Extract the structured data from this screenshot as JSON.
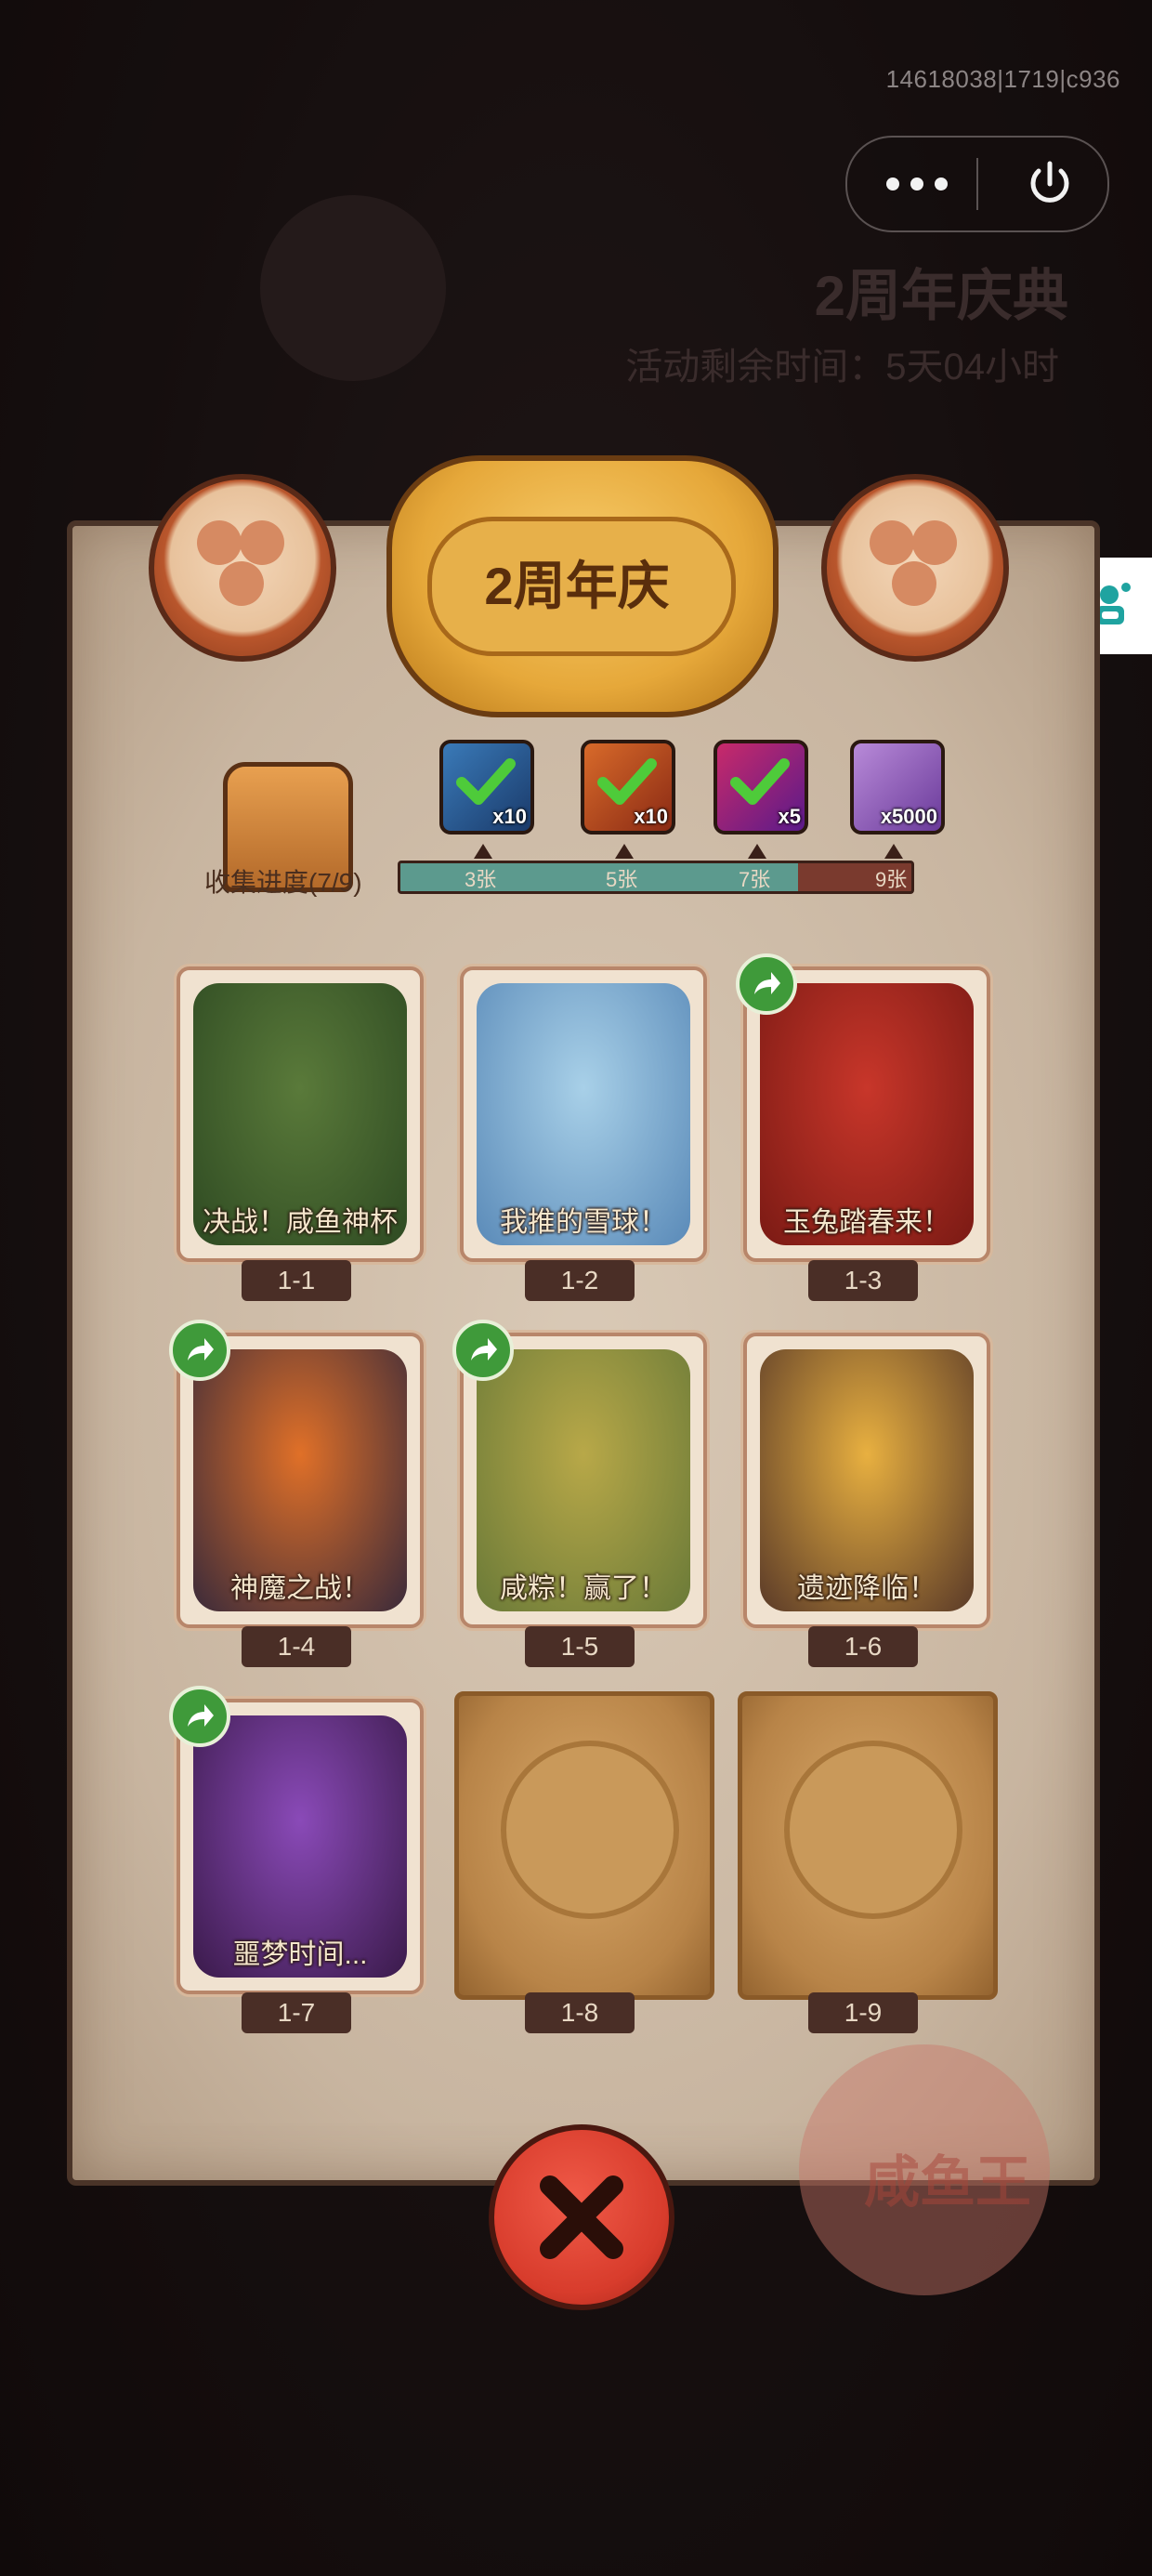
{
  "system": {
    "version_text": "14618038|1719|c936"
  },
  "background": {
    "title": "2周年庆典",
    "subtitle": "活动剩余时间：5天04小时"
  },
  "event": {
    "title": "2周年庆"
  },
  "progress": {
    "label": "收集进度(7/9)",
    "collected": 7,
    "total": 9,
    "milestones": [
      {
        "label": "3张",
        "reward_icon": "treasure-chest-icon",
        "reward_qty": "x10",
        "claimed": true
      },
      {
        "label": "5张",
        "reward_icon": "scroll-ticket-icon",
        "reward_qty": "x10",
        "claimed": true
      },
      {
        "label": "7张",
        "reward_icon": "purple-orb-icon",
        "reward_qty": "x5",
        "claimed": true
      },
      {
        "label": "9张",
        "reward_icon": "crystal-icon",
        "reward_qty": "x5000",
        "claimed": false
      }
    ]
  },
  "cards": [
    {
      "id": "1-1",
      "title": "决战！咸鱼神杯",
      "unlocked": true,
      "shareable": false,
      "palette": [
        "#5a7a3a",
        "#2e4a22"
      ]
    },
    {
      "id": "1-2",
      "title": "我推的雪球！",
      "unlocked": true,
      "shareable": false,
      "palette": [
        "#a8d0e8",
        "#5a8ab8"
      ]
    },
    {
      "id": "1-3",
      "title": "玉兔踏春来！",
      "unlocked": true,
      "shareable": true,
      "palette": [
        "#c8362a",
        "#7a1a14"
      ]
    },
    {
      "id": "1-4",
      "title": "神魔之战！",
      "unlocked": true,
      "shareable": true,
      "palette": [
        "#e07028",
        "#3a2a3a"
      ]
    },
    {
      "id": "1-5",
      "title": "咸粽！赢了！",
      "unlocked": true,
      "shareable": true,
      "palette": [
        "#b8a848",
        "#6a7a38"
      ]
    },
    {
      "id": "1-6",
      "title": "遗迹降临！",
      "unlocked": true,
      "shareable": false,
      "palette": [
        "#e8b040",
        "#5a3a28"
      ]
    },
    {
      "id": "1-7",
      "title": "噩梦时间...",
      "unlocked": true,
      "shareable": true,
      "palette": [
        "#8a4ab8",
        "#3a1a4a"
      ]
    },
    {
      "id": "1-8",
      "title": "",
      "unlocked": false,
      "shareable": false,
      "palette": [
        "#c8995a",
        "#946430"
      ]
    },
    {
      "id": "1-9",
      "title": "",
      "unlocked": false,
      "shareable": false,
      "palette": [
        "#c8995a",
        "#946430"
      ]
    }
  ],
  "colors": {
    "progress_fill": "#5c9a8e",
    "progress_track": "#7a3a2e",
    "close_button": "#d83c2c",
    "share_badge": "#3f9a3a"
  }
}
